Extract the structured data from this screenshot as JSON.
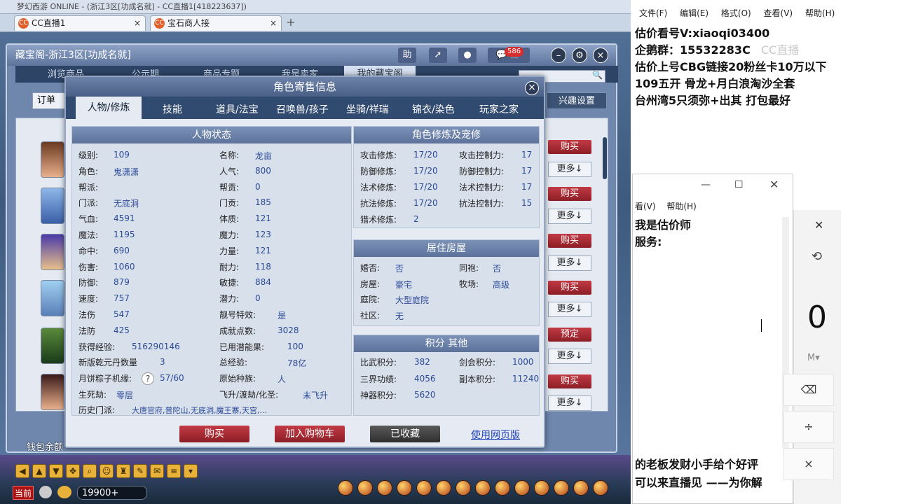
{
  "browser": {
    "title_bar": "梦幻西游 ONLINE - (浙江3区[功成名就] - CC直播1[418223637])",
    "tabs": [
      {
        "label": "CC直播1",
        "close": "×"
      },
      {
        "label": "宝石商人接",
        "close": "×"
      }
    ],
    "add_tab": "+"
  },
  "cbg": {
    "title": "藏宝阁-浙江3区[功成名就]",
    "help": "助",
    "cart_badge": "586",
    "nav_tabs": [
      "浏览商品",
      "公示期",
      "商品专题",
      "我是卖家",
      "我的藏宝阁"
    ],
    "order_label": "订单",
    "interest_button": "兴趣设置",
    "wallet_label": "钱包余额",
    "rows": [
      {
        "action": "购买",
        "more": "更多↓"
      },
      {
        "action": "购买",
        "more": "更多↓"
      },
      {
        "action": "购买",
        "more": "更多↓"
      },
      {
        "action": "购买",
        "more": "更多↓"
      },
      {
        "action": "预定",
        "more": "更多↓"
      },
      {
        "action": "购买",
        "more": "更多↓"
      }
    ]
  },
  "modal": {
    "title": "角色寄售信息",
    "close": "×",
    "tabs": [
      "人物/修炼",
      "技能",
      "道具/法宝",
      "召唤兽/孩子",
      "坐骑/祥瑞",
      "锦衣/染色",
      "玩家之家"
    ],
    "status": {
      "title": "人物状态",
      "left": [
        {
          "k": "级别:",
          "v": "109"
        },
        {
          "k": "角色:",
          "v": "鬼潇潇"
        },
        {
          "k": "帮派:",
          "v": ""
        },
        {
          "k": "门派:",
          "v": "无底洞"
        },
        {
          "k": "气血:",
          "v": "4591"
        },
        {
          "k": "魔法:",
          "v": "1195"
        },
        {
          "k": "命中:",
          "v": "690"
        },
        {
          "k": "伤害:",
          "v": "1060"
        },
        {
          "k": "防御:",
          "v": "879"
        },
        {
          "k": "速度:",
          "v": "757"
        },
        {
          "k": "法伤",
          "v": "547"
        },
        {
          "k": "法防",
          "v": "425"
        },
        {
          "k": "获得经验:",
          "v": "516290146"
        },
        {
          "k": "新版乾元丹数量",
          "v": "3"
        },
        {
          "k": "月饼粽子机缘:",
          "v": "57/60"
        },
        {
          "k": "生死劫:",
          "v": "零层"
        }
      ],
      "right": [
        {
          "k": "名称:",
          "v": "龙亩"
        },
        {
          "k": "人气:",
          "v": "800"
        },
        {
          "k": "帮贡:",
          "v": "0"
        },
        {
          "k": "门贡:",
          "v": "185"
        },
        {
          "k": "体质:",
          "v": "121"
        },
        {
          "k": "魔力:",
          "v": "123"
        },
        {
          "k": "力量:",
          "v": "121"
        },
        {
          "k": "耐力:",
          "v": "118"
        },
        {
          "k": "敏捷:",
          "v": "884"
        },
        {
          "k": "潜力:",
          "v": "0"
        },
        {
          "k": "靓号特效:",
          "v": "是"
        },
        {
          "k": "成就点数:",
          "v": "3028"
        },
        {
          "k": "已用潜能果:",
          "v": "100"
        },
        {
          "k": "总经验:",
          "v": "78亿"
        },
        {
          "k": "原始种族:",
          "v": "人"
        },
        {
          "k": "飞升/渡劫/化圣:",
          "v": "未飞升"
        }
      ],
      "qmark": "?",
      "history_label": "历史门派:",
      "history_value": "大唐官府,普陀山,无底洞,魔王寨,天宫,..."
    },
    "cultivation": {
      "title": "角色修炼及宠修",
      "rows": [
        {
          "k1": "攻击修炼:",
          "v1": "17/20",
          "k2": "攻击控制力:",
          "v2": "17"
        },
        {
          "k1": "防御修炼:",
          "v1": "17/20",
          "k2": "防御控制力:",
          "v2": "17"
        },
        {
          "k1": "法术修炼:",
          "v1": "17/20",
          "k2": "法术控制力:",
          "v2": "17"
        },
        {
          "k1": "抗法修炼:",
          "v1": "17/20",
          "k2": "抗法控制力:",
          "v2": "15"
        },
        {
          "k1": "猎术修炼:",
          "v1": "2",
          "k2": "",
          "v2": ""
        }
      ]
    },
    "house": {
      "title": "居住房屋",
      "rows": [
        {
          "k1": "婚否:",
          "v1": "否",
          "k2": "同袍:",
          "v2": "否"
        },
        {
          "k1": "房屋:",
          "v1": "豪宅",
          "k2": "牧场:",
          "v2": "高级"
        },
        {
          "k1": "庭院:",
          "v1": "大型庭院",
          "k2": "",
          "v2": ""
        },
        {
          "k1": "社区:",
          "v1": "无",
          "k2": "",
          "v2": ""
        }
      ]
    },
    "points": {
      "title": "积分 其他",
      "rows": [
        {
          "k1": "比武积分:",
          "v1": "382",
          "k2": "剑会积分:",
          "v2": "1000"
        },
        {
          "k1": "三界功绩:",
          "v1": "4056",
          "k2": "副本积分:",
          "v2": "11240"
        },
        {
          "k1": "神器积分:",
          "v1": "5620",
          "k2": "",
          "v2": ""
        }
      ]
    },
    "buttons": {
      "buy": "购买",
      "cart": "加入购物车",
      "collected": "已收藏",
      "web": "使用网页版"
    }
  },
  "game_bar": {
    "position": "当前",
    "money": "19900+"
  },
  "notepad": {
    "menu": [
      "文件(F)",
      "编辑(E)",
      "格式(O)",
      "查看(V)",
      "帮助(H)"
    ],
    "lines": [
      "估价看号V:xiaoqi03400",
      "企鹅群：15532283C",
      "估价上号CBG链接20粉丝卡10万以下",
      "109五开 骨龙+月白浪淘沙全套",
      "台州湾5只须弥+出其 打包最好"
    ]
  },
  "notepad2": {
    "menu": [
      "看(V)",
      "帮助(H)"
    ],
    "lines": [
      "我是估价师",
      "服务:"
    ],
    "bottom_lines": [
      "的老板发财小手给个好评",
      "可以来直播见 ——为你解"
    ]
  },
  "calculator": {
    "display": "0",
    "memory": "M▾",
    "buttons": [
      "⌫",
      "÷",
      "×"
    ]
  },
  "watermark": "CC直播",
  "colors": {
    "buy": "#b22c36",
    "accent": "#2b4a98",
    "link": "#1c3fb8"
  }
}
